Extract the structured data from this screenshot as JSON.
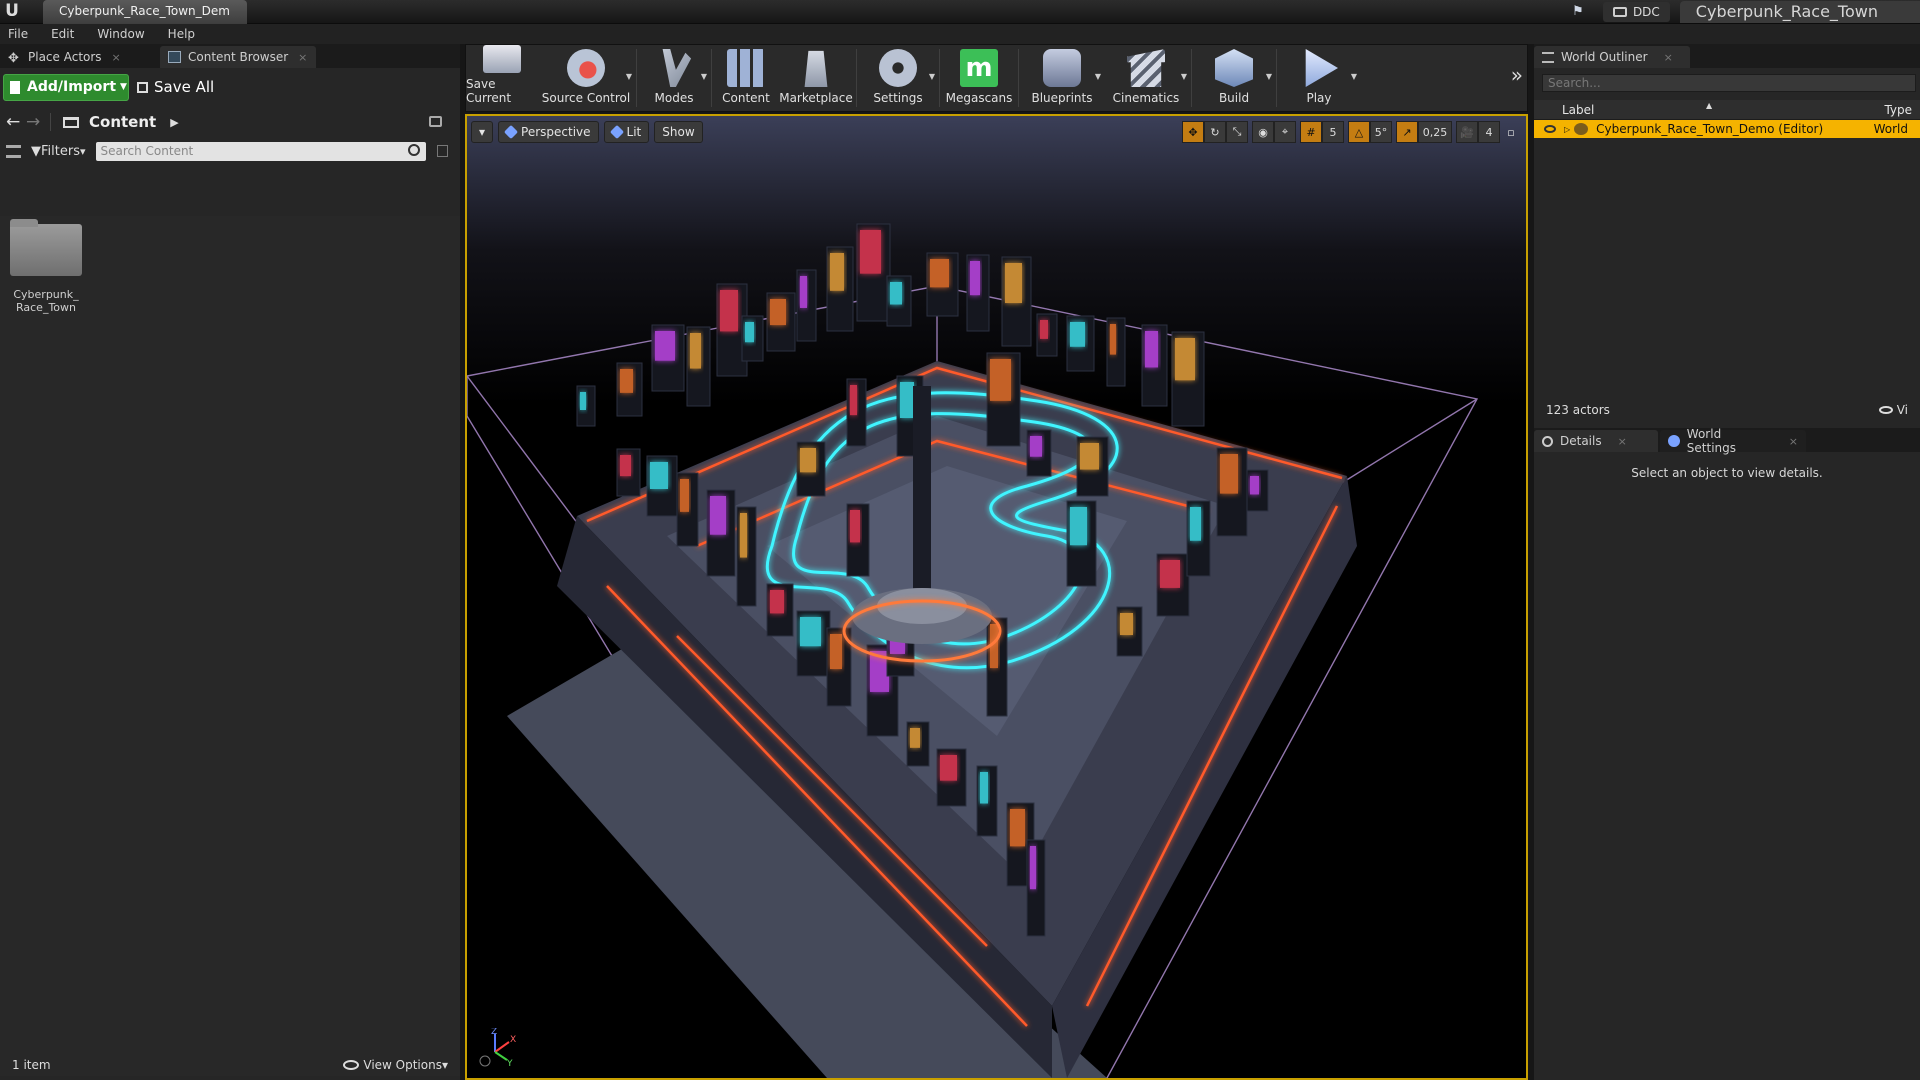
{
  "titlebar": {
    "tab_label": "Cyberpunk_Race_Town_Dem",
    "ddc_label": "DDC",
    "project_name": "Cyberpunk_Race_Town"
  },
  "menu": [
    "File",
    "Edit",
    "Window",
    "Help"
  ],
  "left_panel": {
    "tabs": [
      {
        "label": "Place Actors",
        "icon": "place-actors-icon"
      },
      {
        "label": "Content Browser",
        "icon": "content-browser-icon"
      }
    ],
    "add_import_label": "Add/Import",
    "save_all_label": "Save All",
    "path_label": "Content",
    "filters_label": "Filters",
    "search_placeholder": "Search Content",
    "assets": [
      {
        "name": "Cyberpunk_ Race_Town",
        "icon": "folder-icon"
      }
    ],
    "status_count": "1 item",
    "view_options_label": "View Options"
  },
  "toolbar": {
    "buttons": [
      {
        "label": "Save Current",
        "icon": "save-icon"
      },
      {
        "label": "Source Control",
        "icon": "source-control-icon"
      },
      {
        "label": "Modes",
        "icon": "modes-icon"
      },
      {
        "label": "Content",
        "icon": "content-icon"
      },
      {
        "label": "Marketplace",
        "icon": "marketplace-icon"
      },
      {
        "label": "Settings",
        "icon": "settings-icon"
      },
      {
        "label": "Megascans",
        "icon": "megascans-icon"
      },
      {
        "label": "Blueprints",
        "icon": "blueprints-icon"
      },
      {
        "label": "Cinematics",
        "icon": "cinematics-icon"
      },
      {
        "label": "Build",
        "icon": "build-icon"
      },
      {
        "label": "Play",
        "icon": "play-icon"
      }
    ],
    "megascans_letter": "m"
  },
  "viewport": {
    "perspective_label": "Perspective",
    "lit_label": "Lit",
    "show_label": "Show",
    "grid_snap_value": "5",
    "rotation_snap_value": "5°",
    "scale_snap_value": "0,25",
    "camera_speed_value": "4",
    "accent_color": "#c8a000"
  },
  "world_outliner": {
    "tab_label": "World Outliner",
    "search_placeholder": "Search...",
    "col_label": "Label",
    "col_type": "Type",
    "rows": [
      {
        "label": "Cyberpunk_Race_Town_Demo (Editor)",
        "type": "World",
        "selected": true
      }
    ],
    "actor_count": "123 actors",
    "view_options_label": "Vi"
  },
  "details": {
    "tabs": [
      {
        "label": "Details",
        "icon": "details-icon"
      },
      {
        "label": "World Settings",
        "icon": "world-settings-icon"
      }
    ],
    "empty_message": "Select an object to view details."
  }
}
